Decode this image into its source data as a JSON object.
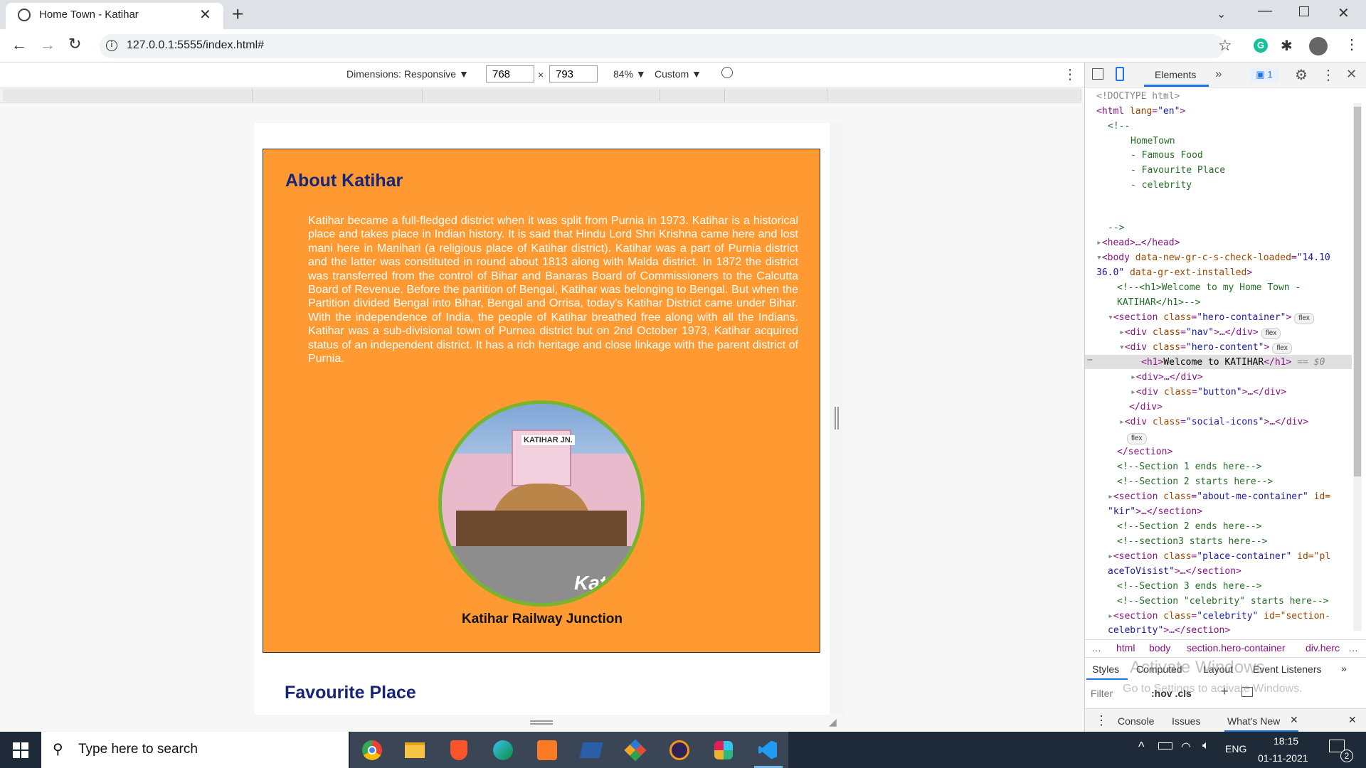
{
  "browser": {
    "tab_title": "Home Town - Katihar",
    "new_tab": "+",
    "url": "127.0.0.1:5555/index.html#",
    "window_controls": [
      "minimize-icon",
      "restore-icon",
      "close-icon"
    ]
  },
  "device_toolbar": {
    "dimensions_label": "Dimensions: Responsive ▼",
    "width": "768",
    "times": "×",
    "height": "793",
    "zoom": "84% ▼",
    "throttle": "Custom ▼"
  },
  "page": {
    "about_heading": "About Katihar",
    "about_text": "Katihar became a full-fledged district when it was split from Purnia in 1973. Katihar is a historical place and takes place in Indian history. It is said that Hindu Lord Shri Krishna came here and lost mani here in Manihari (a religious place of Katihar district). Katihar was a part of Purnia district and the latter was constituted in round about 1813 along with Malda district. In 1872 the district was transferred from the control of Bihar and Banaras Board of Commissioners to the Calcutta Board of Revenue. Before the partition of Bengal, Katihar was belonging to Bengal. But when the Partition divided Bengal into Bihar, Bengal and Orrisa, today's Katihar District came under Bihar. With the independence of India, the people of Katihar breathed free along with all the Indians. Katihar was a sub-divisional town of Purnea district but on 2nd October 1973, Katihar acquired status of an independent district. It has a rich heritage and close linkage with the parent district of Purnia.",
    "photo_sign": "KATIHAR JN.",
    "photo_corner": "Kat",
    "photo_caption": "Katihar Railway Junction",
    "fav_heading": "Favourite Place"
  },
  "devtools": {
    "tabs": {
      "elements": "Elements",
      "more": "»",
      "issues_count": "1"
    },
    "breadcrumb": [
      "…",
      "html",
      "body",
      "section.hero-container",
      "div.herc",
      "…"
    ],
    "styles_tabs": [
      "Styles",
      "Computed",
      "Layout",
      "Event Listeners",
      "»"
    ],
    "filter_placeholder": "Filter",
    "hov_cls": ":hov .cls",
    "drawer_tabs": [
      "Console",
      "Issues",
      "What's New"
    ],
    "watermark_title": "Activate Windows",
    "watermark_sub": "Go to Settings to activate Windows.",
    "flex_badge": "flex",
    "code_lines": {
      "l1": "<!DOCTYPE html>",
      "l2_tag": "<html ",
      "l2_attr": "lang",
      "l2_val": "\"en\"",
      "l3": "<!--",
      "l4": "HomeTown",
      "l5": "- Famous Food",
      "l6": "- Favourite Place",
      "l7": "- celebrity",
      "l8": "-->",
      "l9": "<head>…</head>",
      "l10_a": "<body ",
      "l10_b": "data-new-gr-c-s-check-loaded",
      "l10_c": "\"14.10",
      "l11_a": "36.0\"",
      "l11_b": " data-gr-ext-installed",
      "l11_c": ">",
      "l12": "<!--<h1>Welcome to my Home Town -",
      "l13": "KATIHAR</h1>-->",
      "l14_a": "<section ",
      "l14_b": "class",
      "l14_c": "\"hero-container\"",
      "l15_b": "class",
      "l15_c": "\"nav\"",
      "l16_c": "\"hero-content\"",
      "l17_a": "<h1>",
      "l17_b": "Welcome to KATIHAR",
      "l17_c": "</h1>",
      "l17_d": " == $0",
      "l18": "<div>…</div>",
      "l19_c": "\"button\"",
      "l20": "</div>",
      "l21_c": "\"social-icons\"",
      "l22": "</section>",
      "l23": "<!--Section 1 ends here-->",
      "l24": "<!--Section 2 starts here-->",
      "l25_c": "\"about-me-container\"",
      "l25_d": " id=",
      "l26_a": "\"kir\"",
      "l27": "<!--Section 2 ends here-->",
      "l28": "<!--section3 starts here-->",
      "l29_c": "\"place-container\"",
      "l29_d": " id=\"pl",
      "l30_a": "aceToVisist\"",
      "l31": "<!--Section 3 ends here-->",
      "l32": "<!--Section \"celebrity\" starts here-->",
      "l33_c": "\"celebrity\"",
      "l33_d": " id=\"section-",
      "l34_a": "celebrity\""
    }
  },
  "taskbar": {
    "search_placeholder": "Type here to search",
    "language": "ENG",
    "time": "18:15",
    "date": "01-11-2021",
    "notification_count": "2",
    "apps": [
      "chrome-icon",
      "file-explorer-icon",
      "brave-icon",
      "edge-icon",
      "xampp-icon",
      "powershell-icon",
      "git-icon",
      "eclipse-icon",
      "slack-icon",
      "vscode-icon"
    ]
  },
  "colors": {
    "about_bg": "#ff9a33",
    "heading": "#16247a",
    "photo_border": "#79b52a",
    "taskbar": "#1f2a38"
  }
}
